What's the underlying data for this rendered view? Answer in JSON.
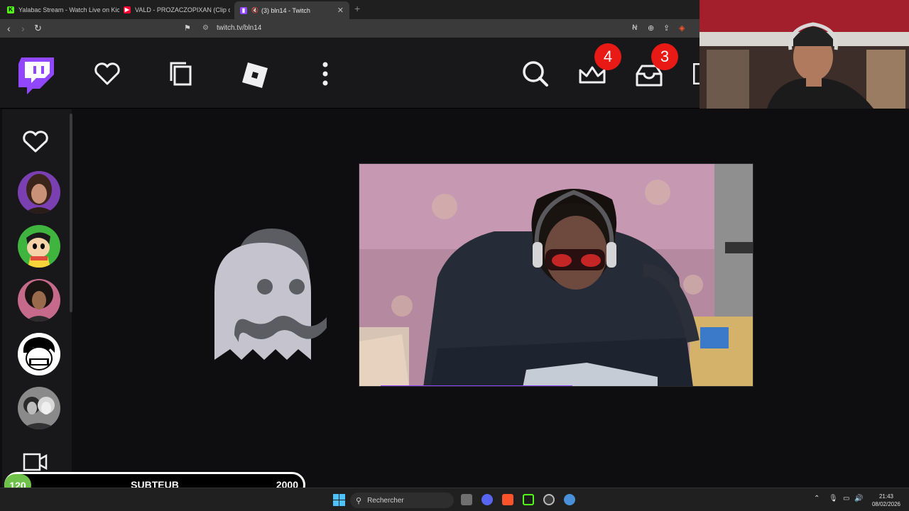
{
  "browser": {
    "tabs": [
      {
        "title": "Yalabac Stream - Watch Live on Kick",
        "favicon": "kick-icon",
        "color": "#53fc18"
      },
      {
        "title": "VALD - PROZACZOPIXAN (Clip officiel)",
        "favicon": "youtube-icon",
        "color": "#ff0033"
      },
      {
        "title": "(3) bln14 - Twitch",
        "favicon": "twitch-icon",
        "color": "#9146ff"
      }
    ],
    "url": "twitch.tv/bln14"
  },
  "twitch_nav": {
    "badges": {
      "prime": "4",
      "inbox": "3"
    }
  },
  "overlay": {
    "current": "120",
    "label": "SUBTEUB",
    "goal": "2000",
    "progress_fraction": 0.06
  },
  "taskbar": {
    "search_placeholder": "Rechercher",
    "time": "21:43",
    "date": "08/02/2026"
  },
  "colors": {
    "twitch_purple": "#9146ff",
    "badge_red": "#e91916",
    "goal_green": "#6ec24a"
  }
}
